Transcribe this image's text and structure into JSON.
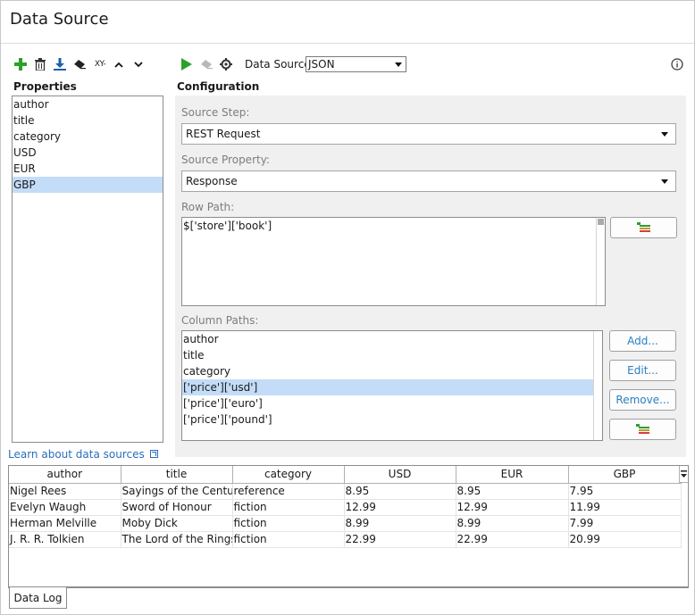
{
  "header": {
    "title": "Data Source"
  },
  "toolbar": {
    "xy_label": "XY-",
    "data_source_label": "Data Source:",
    "data_source_value": "JSON"
  },
  "properties": {
    "heading": "Properties",
    "items": [
      "author",
      "title",
      "category",
      "USD",
      "EUR",
      "GBP"
    ],
    "selected": "GBP"
  },
  "configuration": {
    "heading": "Configuration",
    "source_step_label": "Source Step:",
    "source_step_value": "REST Request",
    "source_property_label": "Source Property:",
    "source_property_value": "Response",
    "row_path_label": "Row Path:",
    "row_path_value": "$['store']['book']",
    "column_paths_label": "Column Paths:",
    "column_paths": [
      "author",
      "title",
      "category",
      "['price']['usd']",
      "['price']['euro']",
      "['price']['pound']"
    ],
    "column_selected": "['price']['usd']",
    "add_label": "Add...",
    "edit_label": "Edit...",
    "remove_label": "Remove..."
  },
  "learn_link": "Learn about data sources",
  "grid": {
    "columns": [
      "author",
      "title",
      "category",
      "USD",
      "EUR",
      "GBP"
    ],
    "rows": [
      [
        "Nigel Rees",
        "Sayings of the Century",
        "reference",
        "8.95",
        "8.95",
        "7.95"
      ],
      [
        "Evelyn Waugh",
        "Sword of Honour",
        "fiction",
        "12.99",
        "12.99",
        "11.99"
      ],
      [
        "Herman Melville",
        "Moby Dick",
        "fiction",
        "8.99",
        "8.99",
        "7.99"
      ],
      [
        "J. R. R. Tolkien",
        "The Lord of the Rings",
        "fiction",
        "22.99",
        "22.99",
        "20.99"
      ]
    ]
  },
  "tabs": {
    "data_log": "Data Log"
  },
  "colors": {
    "accent_green": "#2ca02c",
    "selection": "#c3dcf7",
    "link_blue": "#2a6ebb"
  }
}
